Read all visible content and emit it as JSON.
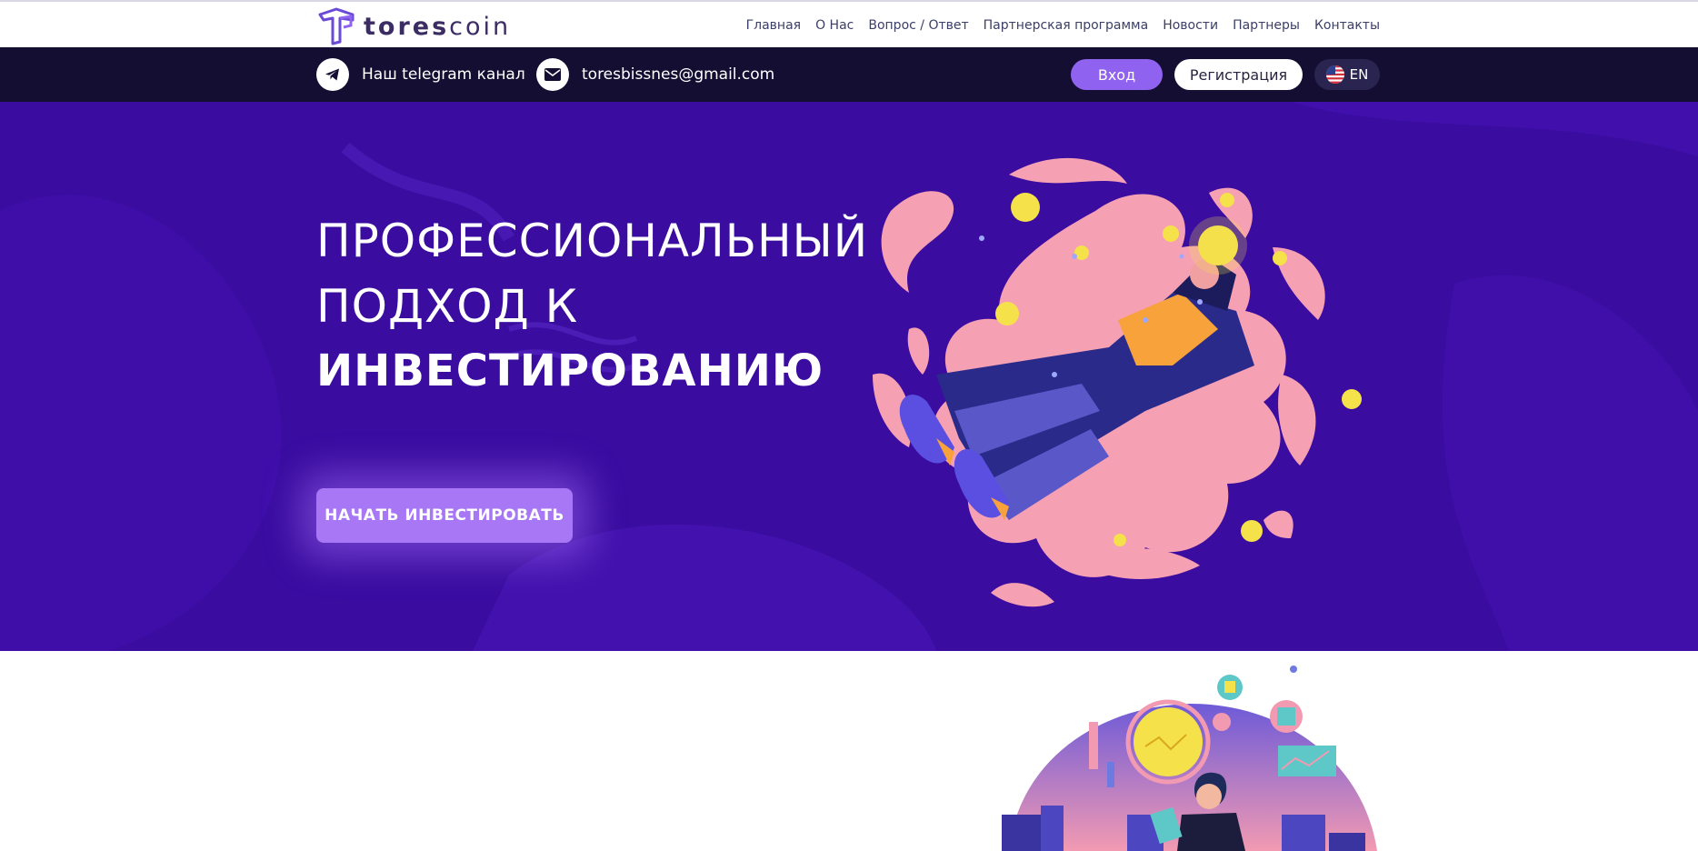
{
  "header": {
    "logo_text_bold": "tores",
    "logo_text_light": "coin",
    "nav": [
      "Главная",
      "О Нас",
      "Вопрос / Ответ",
      "Партнерская программа",
      "Новости",
      "Партнеры",
      "Контакты"
    ]
  },
  "contact": {
    "telegram_label": "Наш telegram канал",
    "email": "toresbissnes@gmail.com",
    "login_label": "Вход",
    "register_label": "Регистрация",
    "language": "EN"
  },
  "hero": {
    "line1": "ПРОФЕССИОНАЛЬНЫЙ",
    "line2": "ПОДХОД К",
    "line3": "ИНВЕСТИРОВАНИЮ",
    "cta_label": "НАЧАТЬ ИНВЕСТИРОВАТЬ"
  },
  "colors": {
    "hero_bg": "#3a0ca0",
    "contact_bar_bg": "#140e33",
    "accent": "#8f63f0",
    "cta": "#a777f5",
    "coin": "#f5e14a",
    "blob_pink": "#f6a0b4"
  },
  "icons": [
    "logo-mark-icon",
    "telegram-icon",
    "mail-icon",
    "us-flag-icon"
  ]
}
